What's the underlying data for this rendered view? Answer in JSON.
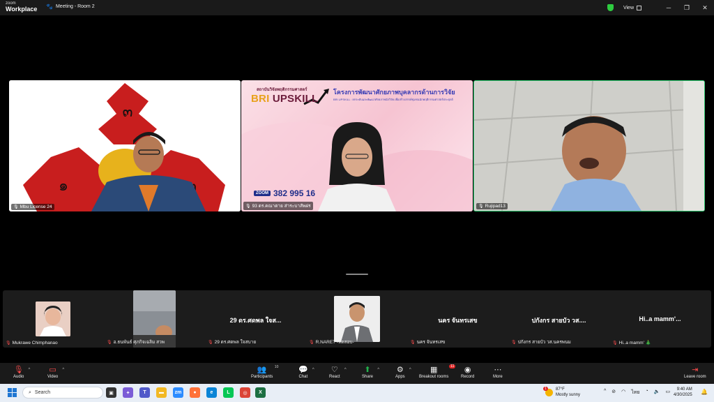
{
  "titlebar": {
    "brand_top": "zoom",
    "brand_bottom": "Workplace",
    "meeting_title": "Meeting - Room 2",
    "view_label": "View"
  },
  "video_tiles": [
    {
      "name": "Mbu License 24"
    },
    {
      "name": "93 ดร.คณาตาย ส่าระบาสัพผ่ร"
    },
    {
      "name": "Rujipad13"
    }
  ],
  "slide": {
    "institute": "สถาบันวิจัยพฤติกรรมศาสตร์",
    "logo_bri": "BRI",
    "logo_upskill": "UPSKILL",
    "title": "โครงการพัฒนาศักยภาพบุคลากรด้านการวิจัย",
    "subtitle": "BRI UPSKILL : ยกระดับและพัฒนาศักยภาพนักวิจัย เพื่อสร้างสรรค์ชุมชนนักพฤติกรรมศาสตร์ประยุกต์",
    "zoom_label": "ZOOM",
    "zoom_id": "382 995 16"
  },
  "gallery": [
    {
      "name": "Mukrawe Chimphanao",
      "display": ""
    },
    {
      "name": "อ.ธนพันธ์ ศุภกิจเฉลิม สวพ",
      "display": ""
    },
    {
      "name": "29 ดร.ศดพล ใจสบาย",
      "display": "29 ดร.ศดพล ใจส..."
    },
    {
      "name": "R.NARET -ทดสอบ-",
      "display": ""
    },
    {
      "name": "นคร จันทรเสข",
      "display": "นคร จันทรเสข"
    },
    {
      "name": "ปกังกร สายบัว วส.นครพนม",
      "display": "ปกังกร สายบัว วส...."
    },
    {
      "name": "Hi..a mamm' 🎄",
      "display": "Hi..a mamm'..."
    }
  ],
  "controls": {
    "audio": "Audio",
    "video": "Video",
    "participants": "Participants",
    "participants_count": "10",
    "chat": "Chat",
    "react": "React",
    "share": "Share",
    "apps": "Apps",
    "breakout": "Breakout rooms",
    "breakout_badge": "11",
    "record": "Record",
    "more": "More",
    "leave": "Leave room"
  },
  "taskbar": {
    "search_placeholder": "Search",
    "weather_temp": "87°F",
    "weather_desc": "Mostly sunny",
    "weather_badge": "1",
    "lang": "ไทย",
    "time": "9:40 AM",
    "date": "4/30/2025"
  },
  "colors": {
    "accent_green": "#2ecc71",
    "mute_red": "#ff4d4d",
    "share_green": "#23b14d"
  }
}
